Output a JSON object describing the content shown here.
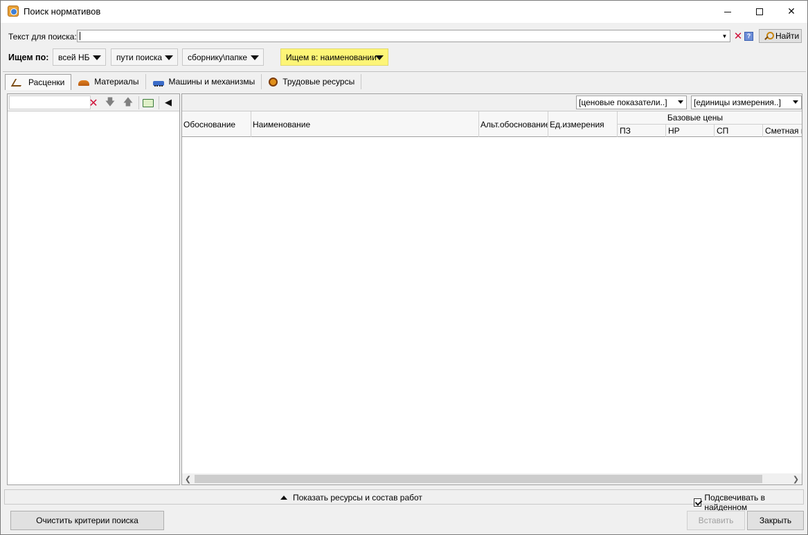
{
  "window": {
    "title": "Поиск нормативов"
  },
  "search": {
    "label": "Текст для поиска:",
    "value": "",
    "find_label": "Найти",
    "help_glyph": "?"
  },
  "search_by": {
    "label": "Ищем по:",
    "nb": "всей НБ",
    "paths": "пути поиска",
    "collection": "сборнику\\папке",
    "where": "Ищем в: наименовании"
  },
  "tabs": [
    {
      "label": "Расценки",
      "icon": "rates-icon",
      "active": true
    },
    {
      "label": "Материалы",
      "icon": "materials-icon",
      "active": false
    },
    {
      "label": "Машины и механизмы",
      "icon": "machines-icon",
      "active": false
    },
    {
      "label": "Трудовые ресурсы",
      "icon": "labor-icon",
      "active": false
    }
  ],
  "right_toolbar": {
    "price_indicators": "[ценовые показатели..]",
    "units": "[единицы измерения..]"
  },
  "grid": {
    "columns": [
      "Обоснование",
      "Наименование",
      "Альт.обоснование",
      "Ед.измерения"
    ],
    "group_label": "Базовые цены",
    "group_columns": [
      "ПЗ",
      "НР",
      "СП",
      "Сметная ц"
    ]
  },
  "bottom": {
    "show_resources": "Показать ресурсы и состав работ",
    "highlight": "Подсвечивать в найденном",
    "highlight_checked": true,
    "clear_btn": "Очистить критерии поиска",
    "insert_btn": "Вставить",
    "close_btn": "Закрыть"
  },
  "colors": {
    "accent_yellow": "#fdf577",
    "clear_red": "#d0103a"
  }
}
